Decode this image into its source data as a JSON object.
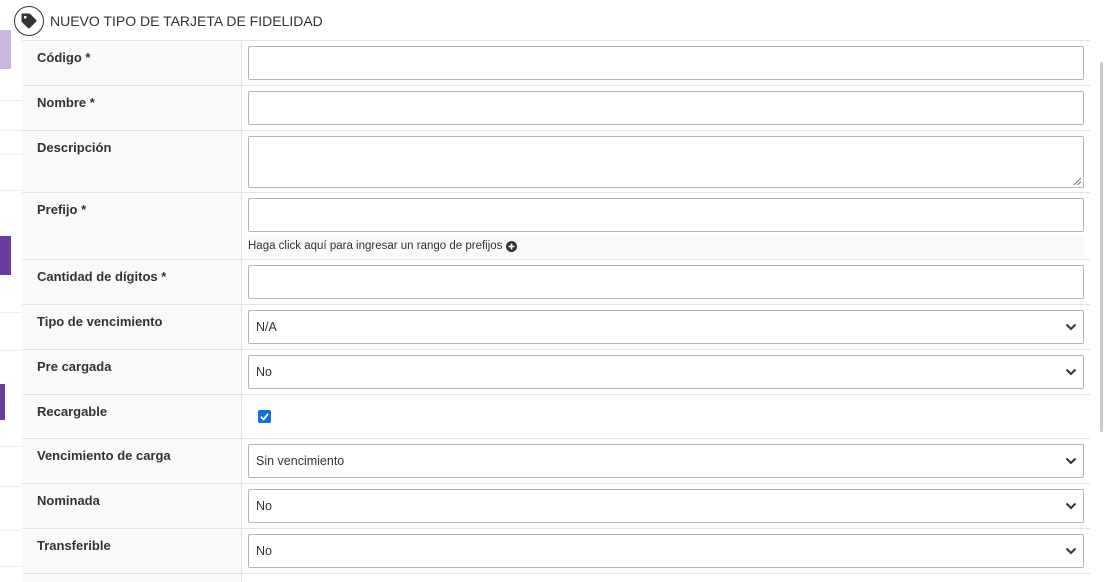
{
  "page": {
    "title": "NUEVO TIPO DE TARJETA DE FIDELIDAD",
    "title_icon": "tag-icon"
  },
  "colors": {
    "accent": "#6a3c9c",
    "accent_light": "#cbb6dd",
    "checkbox": "#0b72d8",
    "label_bg": "#f9f9f9",
    "border": "#e4e4e4"
  },
  "form": {
    "codigo": {
      "label": "Código *",
      "value": ""
    },
    "nombre": {
      "label": "Nombre *",
      "value": ""
    },
    "descripcion": {
      "label": "Descripción",
      "value": ""
    },
    "prefijo": {
      "label": "Prefijo *",
      "value": "",
      "helper": "Haga click aquí para ingresar un rango de prefijos",
      "helper_icon": "plus-circle-icon"
    },
    "cantidad_digitos": {
      "label": "Cantidad de dígitos *",
      "value": ""
    },
    "tipo_vencimiento": {
      "label": "Tipo de vencimiento",
      "selected": "N/A"
    },
    "pre_cargada": {
      "label": "Pre cargada",
      "selected": "No"
    },
    "recargable": {
      "label": "Recargable",
      "checked": true
    },
    "vencimiento_carga": {
      "label": "Vencimiento de carga",
      "selected": "Sin vencimiento"
    },
    "nominada": {
      "label": "Nominada",
      "selected": "No"
    },
    "transferible": {
      "label": "Transferible",
      "selected": "No"
    }
  }
}
